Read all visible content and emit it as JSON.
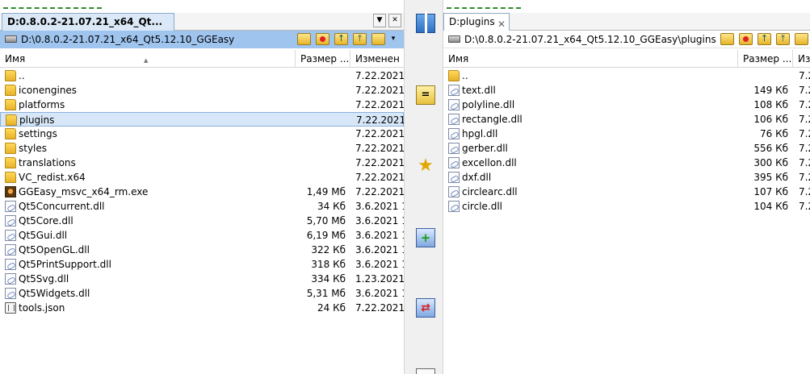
{
  "left": {
    "tab_title": "D:0.8.0.2-21.07.21_x64_Qt...",
    "tab_dropdown": "▼",
    "tab_close": "✕",
    "path": "D:\\0.8.0.2-21.07.21_x64_Qt5.12.10_GGEasy",
    "path_caret": "▾",
    "columns": {
      "name": "Имя",
      "size": "Размер ...",
      "modified": "Изменен"
    },
    "files": [
      {
        "name": "..",
        "size": "",
        "date": "7.22.2021",
        "icon": "folder-icon"
      },
      {
        "name": "iconengines",
        "size": "",
        "date": "7.22.2021",
        "icon": "folder-icon"
      },
      {
        "name": "platforms",
        "size": "",
        "date": "7.22.2021",
        "icon": "folder-icon"
      },
      {
        "name": "plugins",
        "size": "",
        "date": "7.22.2021",
        "icon": "folder-icon"
      },
      {
        "name": "settings",
        "size": "",
        "date": "7.22.2021",
        "icon": "folder-icon"
      },
      {
        "name": "styles",
        "size": "",
        "date": "7.22.2021",
        "icon": "folder-icon"
      },
      {
        "name": "translations",
        "size": "",
        "date": "7.22.2021",
        "icon": "folder-icon"
      },
      {
        "name": "VC_redist.x64",
        "size": "",
        "date": "7.22.2021",
        "icon": "folder-icon"
      },
      {
        "name": "GGEasy_msvc_x64_rm.exe",
        "size": "1,49 Мб",
        "date": "7.22.2021",
        "icon": "exe-icon"
      },
      {
        "name": "Qt5Concurrent.dll",
        "size": "34 Кб",
        "date": "3.6.2021 1",
        "icon": "dll-icon"
      },
      {
        "name": "Qt5Core.dll",
        "size": "5,70 Мб",
        "date": "3.6.2021 1",
        "icon": "dll-icon"
      },
      {
        "name": "Qt5Gui.dll",
        "size": "6,19 Мб",
        "date": "3.6.2021 1",
        "icon": "dll-icon"
      },
      {
        "name": "Qt5OpenGL.dll",
        "size": "322 Кб",
        "date": "3.6.2021 1",
        "icon": "dll-icon"
      },
      {
        "name": "Qt5PrintSupport.dll",
        "size": "318 Кб",
        "date": "3.6.2021 1",
        "icon": "dll-icon"
      },
      {
        "name": "Qt5Svg.dll",
        "size": "334 Кб",
        "date": "1.23.2021",
        "icon": "dll-icon"
      },
      {
        "name": "Qt5Widgets.dll",
        "size": "5,31 Мб",
        "date": "3.6.2021 1",
        "icon": "dll-icon"
      },
      {
        "name": "tools.json",
        "size": "24 Кб",
        "date": "7.22.2021",
        "icon": "json-icon"
      }
    ]
  },
  "right": {
    "tab_title": "D:plugins",
    "tab_close": "✕",
    "path": "D:\\0.8.0.2-21.07.21_x64_Qt5.12.10_GGEasy\\plugins",
    "columns": {
      "name": "Имя",
      "size": "Размер ...",
      "modified": "Из"
    },
    "files": [
      {
        "name": "..",
        "size": "",
        "date": "7.2",
        "icon": "folder-icon"
      },
      {
        "name": "text.dll",
        "size": "149 Кб",
        "date": "7.2",
        "icon": "dll-icon"
      },
      {
        "name": "polyline.dll",
        "size": "108 Кб",
        "date": "7.2",
        "icon": "dll-icon"
      },
      {
        "name": "rectangle.dll",
        "size": "106 Кб",
        "date": "7.2",
        "icon": "dll-icon"
      },
      {
        "name": "hpgl.dll",
        "size": "76 Кб",
        "date": "7.2",
        "icon": "dll-icon"
      },
      {
        "name": "gerber.dll",
        "size": "556 Кб",
        "date": "7.2",
        "icon": "dll-icon"
      },
      {
        "name": "excellon.dll",
        "size": "300 Кб",
        "date": "7.2",
        "icon": "dll-icon"
      },
      {
        "name": "dxf.dll",
        "size": "395 Кб",
        "date": "7.2",
        "icon": "dll-icon"
      },
      {
        "name": "circlearc.dll",
        "size": "107 Кб",
        "date": "7.2",
        "icon": "dll-icon"
      },
      {
        "name": "circle.dll",
        "size": "104 Кб",
        "date": "7.2",
        "icon": "dll-icon"
      }
    ]
  },
  "toolbar": {
    "items": [
      {
        "name": "archive-tool-icon",
        "glyph": ""
      },
      {
        "name": "compare-tool-icon",
        "glyph": "="
      },
      {
        "name": "magic-tool-icon",
        "glyph": "★"
      },
      {
        "name": "add-tool-icon",
        "glyph": "+"
      },
      {
        "name": "sync-tool-icon",
        "glyph": "⇄"
      },
      {
        "name": "document-tool-icon",
        "glyph": ""
      }
    ]
  },
  "colors": {
    "active_path_bg": "#9fc4ee",
    "selection_bg": "#d8e7f8",
    "tab_active_bg": "#dbe8f7",
    "progress_dash": "#2e8b2e"
  }
}
